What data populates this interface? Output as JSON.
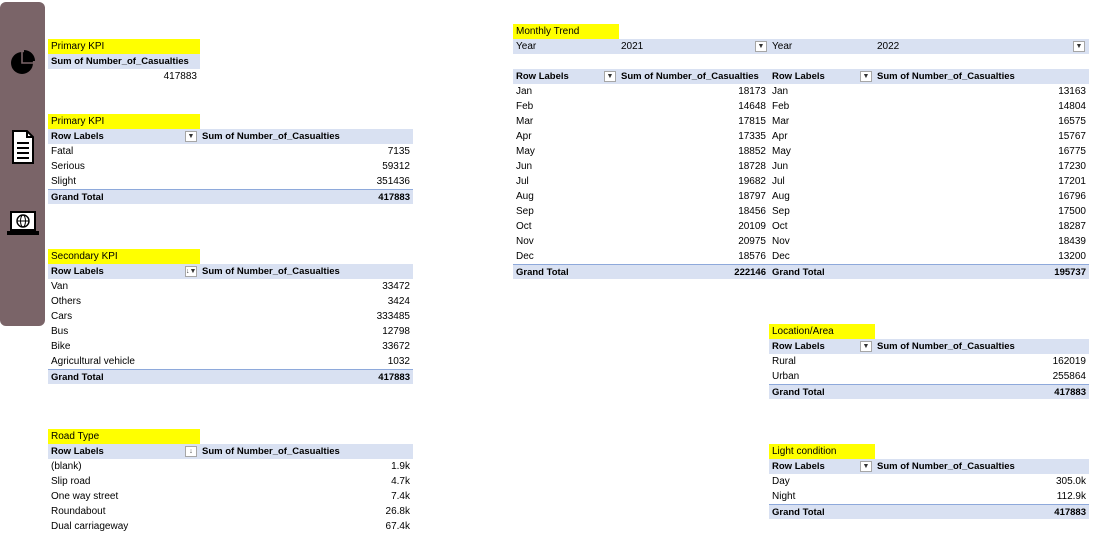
{
  "sidebar": {
    "icons": [
      "pie-chart-icon",
      "document-icon",
      "laptop-globe-icon"
    ]
  },
  "kpi1": {
    "title": "Primary KPI",
    "header": "Sum of Number_of_Casualties",
    "value": "417883"
  },
  "kpi2": {
    "title": "Primary KPI",
    "row_labels": "Row Labels",
    "col_header": "Sum of Number_of_Casualties",
    "rows": [
      {
        "label": "Fatal",
        "value": "7135"
      },
      {
        "label": "Serious",
        "value": "59312"
      },
      {
        "label": "Slight",
        "value": "351436"
      }
    ],
    "total_label": "Grand Total",
    "total_value": "417883"
  },
  "secondary": {
    "title": "Secondary KPI",
    "row_labels": "Row Labels",
    "col_header": "Sum of Number_of_Casualties",
    "rows": [
      {
        "label": "Van",
        "value": "33472"
      },
      {
        "label": "Others",
        "value": "3424"
      },
      {
        "label": "Cars",
        "value": "333485"
      },
      {
        "label": "Bus",
        "value": "12798"
      },
      {
        "label": "Bike",
        "value": "33672"
      },
      {
        "label": "Agricultural vehicle",
        "value": "1032"
      }
    ],
    "total_label": "Grand Total",
    "total_value": "417883"
  },
  "road": {
    "title": "Road Type",
    "row_labels": "Row Labels",
    "col_header": "Sum of Number_of_Casualties",
    "rows": [
      {
        "label": "(blank)",
        "value": "1.9k"
      },
      {
        "label": "Slip road",
        "value": "4.7k"
      },
      {
        "label": "One way street",
        "value": "7.4k"
      },
      {
        "label": "Roundabout",
        "value": "26.8k"
      },
      {
        "label": "Dual carriageway",
        "value": "67.4k"
      }
    ]
  },
  "monthly": {
    "title": "Monthly Trend",
    "filter1_label": "Year",
    "filter1_value": "2021",
    "filter2_label": "Year",
    "filter2_value": "2022",
    "row_labels": "Row Labels",
    "col_header": "Sum of Number_of_Casualties",
    "rows2021": [
      {
        "label": "Jan",
        "value": "18173"
      },
      {
        "label": "Feb",
        "value": "14648"
      },
      {
        "label": "Mar",
        "value": "17815"
      },
      {
        "label": "Apr",
        "value": "17335"
      },
      {
        "label": "May",
        "value": "18852"
      },
      {
        "label": "Jun",
        "value": "18728"
      },
      {
        "label": "Jul",
        "value": "19682"
      },
      {
        "label": "Aug",
        "value": "18797"
      },
      {
        "label": "Sep",
        "value": "18456"
      },
      {
        "label": "Oct",
        "value": "20109"
      },
      {
        "label": "Nov",
        "value": "20975"
      },
      {
        "label": "Dec",
        "value": "18576"
      }
    ],
    "rows2022": [
      {
        "label": "Jan",
        "value": "13163"
      },
      {
        "label": "Feb",
        "value": "14804"
      },
      {
        "label": "Mar",
        "value": "16575"
      },
      {
        "label": "Apr",
        "value": "15767"
      },
      {
        "label": "May",
        "value": "16775"
      },
      {
        "label": "Jun",
        "value": "17230"
      },
      {
        "label": "Jul",
        "value": "17201"
      },
      {
        "label": "Aug",
        "value": "16796"
      },
      {
        "label": "Sep",
        "value": "17500"
      },
      {
        "label": "Oct",
        "value": "18287"
      },
      {
        "label": "Nov",
        "value": "18439"
      },
      {
        "label": "Dec",
        "value": "13200"
      }
    ],
    "total_label": "Grand Total",
    "total2021": "222146",
    "total2022": "195737"
  },
  "location": {
    "title": "Location/Area",
    "row_labels": "Row Labels",
    "col_header": "Sum of Number_of_Casualties",
    "rows": [
      {
        "label": "Rural",
        "value": "162019"
      },
      {
        "label": "Urban",
        "value": "255864"
      }
    ],
    "total_label": "Grand Total",
    "total_value": "417883"
  },
  "light": {
    "title": "Light condition",
    "row_labels": "Row Labels",
    "col_header": "Sum of Number_of_Casualties",
    "rows": [
      {
        "label": "Day",
        "value": "305.0k"
      },
      {
        "label": "Night",
        "value": "112.9k"
      }
    ],
    "total_label": "Grand Total",
    "total_value": "417883"
  }
}
